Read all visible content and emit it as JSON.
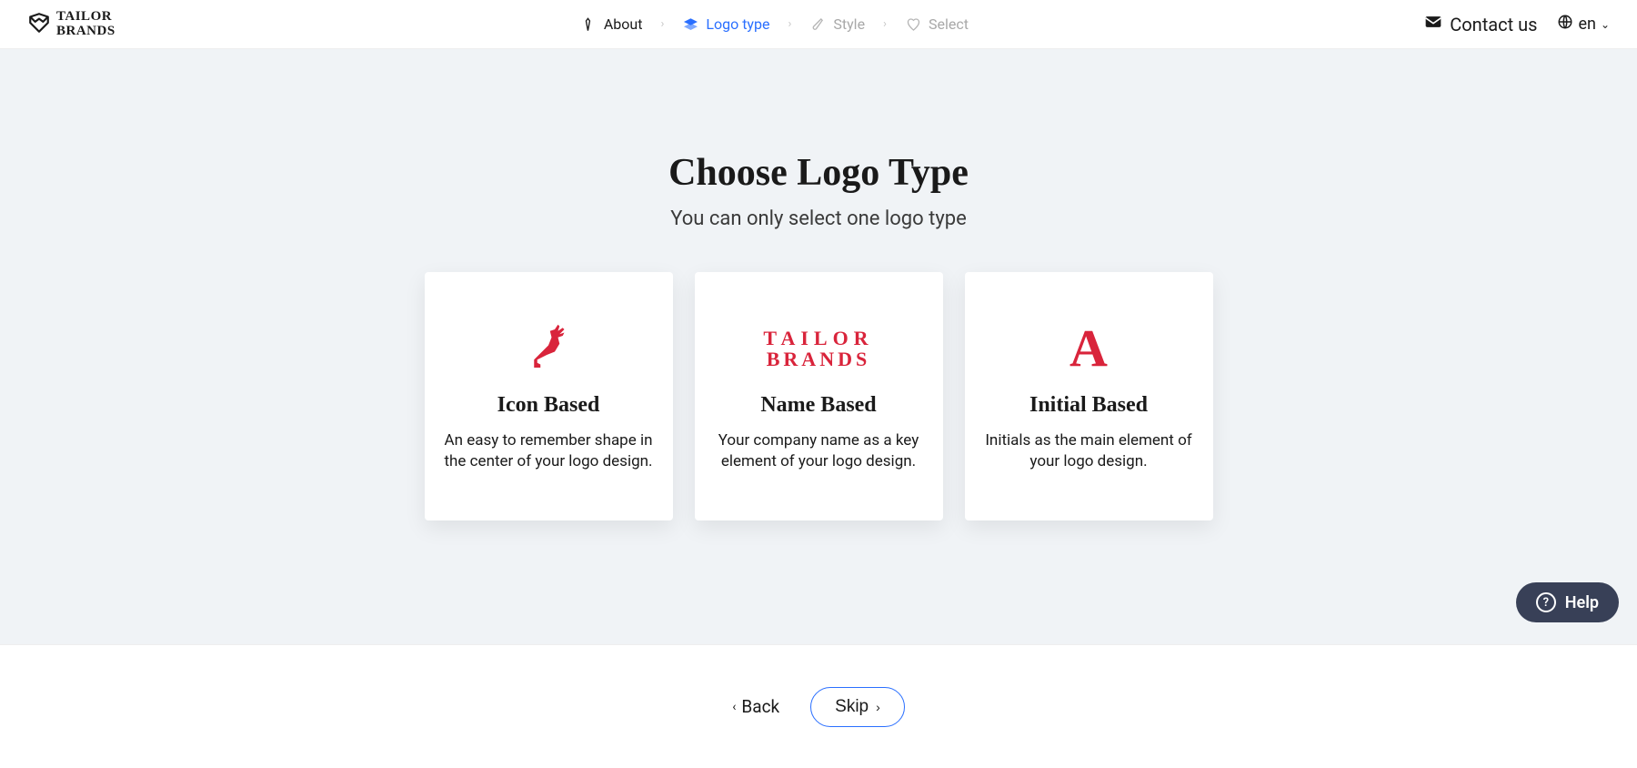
{
  "brand": {
    "line1": "TAILOR",
    "line2": "BRANDS"
  },
  "breadcrumbs": [
    {
      "label": "About",
      "state": "done"
    },
    {
      "label": "Logo type",
      "state": "active"
    },
    {
      "label": "Style",
      "state": "pending"
    },
    {
      "label": "Select",
      "state": "pending"
    }
  ],
  "header": {
    "contact": "Contact us",
    "lang": "en"
  },
  "main": {
    "title": "Choose Logo Type",
    "subtitle": "You can only select one logo type"
  },
  "cards": [
    {
      "title": "Icon Based",
      "desc": "An easy to remember shape in the center of your logo design."
    },
    {
      "title": "Name Based",
      "desc": "Your company name as a key element of your logo design.",
      "sample_line1": "TAILOR",
      "sample_line2": "BRANDS"
    },
    {
      "title": "Initial Based",
      "desc": "Initials as the main element of your logo design.",
      "sample_initial": "A"
    }
  ],
  "footer": {
    "back": "Back",
    "skip": "Skip"
  },
  "help": {
    "label": "Help"
  }
}
